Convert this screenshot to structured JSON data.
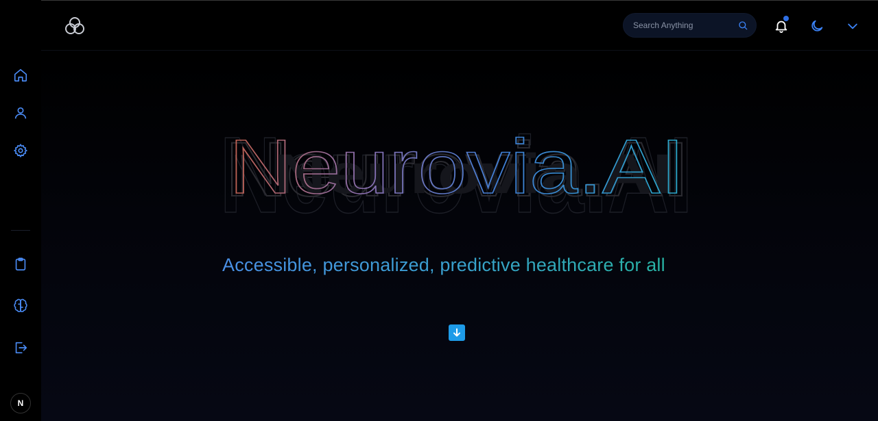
{
  "app": {
    "brand": "Neurovia.AI",
    "badge": "N"
  },
  "header": {
    "search": {
      "placeholder": "Search Anything",
      "icon": "search-icon"
    },
    "notification": {
      "icon": "bell-icon",
      "has_unread": true
    },
    "theme_toggle": {
      "icon": "moon-icon"
    },
    "account_menu": {
      "icon": "chevron-down-icon"
    }
  },
  "sidebar": {
    "top_items": [
      {
        "name": "home",
        "icon": "home-icon"
      },
      {
        "name": "profile",
        "icon": "user-icon"
      },
      {
        "name": "settings",
        "icon": "gear-icon"
      }
    ],
    "bottom_items": [
      {
        "name": "clipboard",
        "icon": "clipboard-icon"
      },
      {
        "name": "brain",
        "icon": "brain-icon"
      },
      {
        "name": "logout",
        "icon": "logout-icon"
      }
    ]
  },
  "hero": {
    "title": "Neurovia.AI",
    "tagline": "Accessible, personalized, predictive healthcare for all",
    "scroll_icon": "arrow-down-icon"
  },
  "colors": {
    "accent": "#3b82f6",
    "title_gradient": [
      "#c0604f",
      "#8a6fb0",
      "#3f7fd6",
      "#2aa8c8"
    ],
    "tagline_gradient": [
      "#4a90e6",
      "#28b3a4"
    ],
    "scroll_button": "#1e9be8"
  }
}
